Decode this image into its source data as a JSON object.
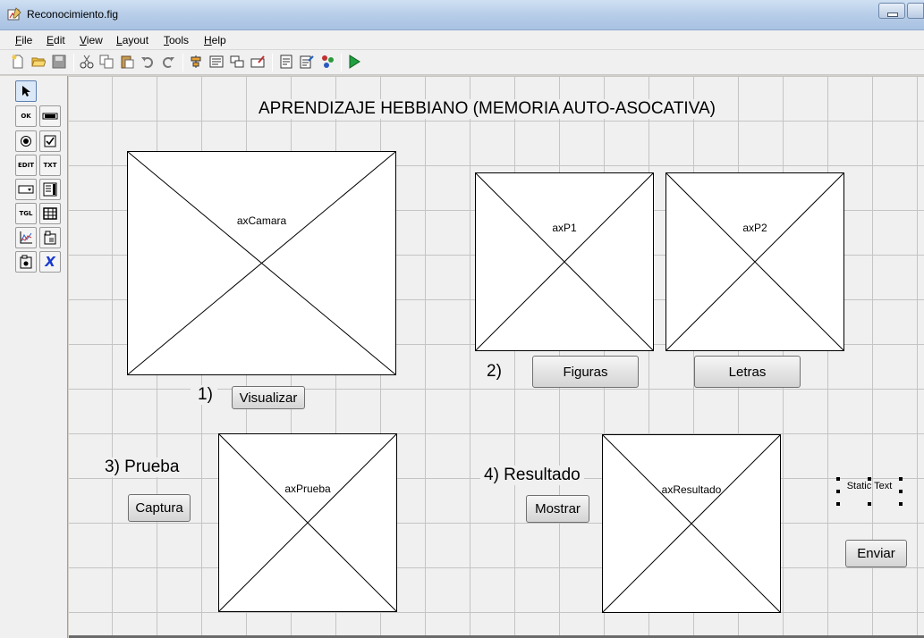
{
  "window": {
    "title": "Reconocimiento.fig"
  },
  "menu": [
    "File",
    "Edit",
    "View",
    "Layout",
    "Tools",
    "Help"
  ],
  "toolbar": {
    "icons": [
      "new-file-icon",
      "open-folder-icon",
      "save-icon",
      "cut-icon",
      "copy-icon",
      "paste-icon",
      "undo-icon",
      "redo-icon",
      "align-icon",
      "menu-editor-icon",
      "tab-order-icon",
      "toolbar-editor-icon",
      "m-file-editor-icon",
      "property-inspector-icon",
      "object-browser-icon",
      "run-icon"
    ]
  },
  "palette": {
    "items": [
      {
        "name": "select-tool",
        "label": ""
      },
      {
        "name": "push-button-tool",
        "label": "OK"
      },
      {
        "name": "slider-tool",
        "label": ""
      },
      {
        "name": "radio-button-tool",
        "label": ""
      },
      {
        "name": "checkbox-tool",
        "label": ""
      },
      {
        "name": "edit-text-tool",
        "label": "EDIT"
      },
      {
        "name": "static-text-tool",
        "label": "TXT"
      },
      {
        "name": "popup-menu-tool",
        "label": ""
      },
      {
        "name": "listbox-tool",
        "label": ""
      },
      {
        "name": "toggle-button-tool",
        "label": "TGL"
      },
      {
        "name": "table-tool",
        "label": ""
      },
      {
        "name": "axes-tool",
        "label": ""
      },
      {
        "name": "panel-tool",
        "label": ""
      },
      {
        "name": "button-group-tool",
        "label": ""
      },
      {
        "name": "activex-tool",
        "label": "X"
      }
    ]
  },
  "canvas": {
    "title": "APRENDIZAJE HEBBIANO (MEMORIA AUTO-ASOCATIVA)",
    "step1": "1)",
    "step2": "2)",
    "step3": "3) Prueba",
    "step4": "4) Resultado",
    "static_text": "Static Text",
    "axes": {
      "camara": "axCamara",
      "p1": "axP1",
      "p2": "axP2",
      "prueba": "axPrueba",
      "resultado": "axResultado"
    },
    "buttons": {
      "visualizar": "Visualizar",
      "figuras": "Figuras",
      "letras": "Letras",
      "captura": "Captura",
      "mostrar": "Mostrar",
      "enviar": "Enviar"
    }
  }
}
